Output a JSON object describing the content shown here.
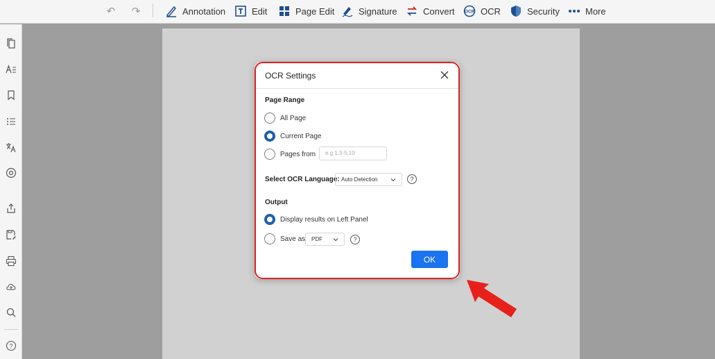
{
  "toolbar": {
    "annotation": "Annotation",
    "edit": "Edit",
    "page_edit": "Page Edit",
    "signature": "Signature",
    "convert": "Convert",
    "ocr": "OCR",
    "security": "Security",
    "more": "More"
  },
  "dialog": {
    "title": "OCR Settings",
    "page_range": {
      "label": "Page Range",
      "options": [
        "All Page",
        "Current Page",
        "Pages from"
      ],
      "selected": "Current Page",
      "pages_placeholder": "e.g 1,3-5,10"
    },
    "language": {
      "label": "Select OCR Language:",
      "value": "Auto Detection"
    },
    "output": {
      "label": "Output",
      "options": [
        "Display results on Left Panel",
        "Save as"
      ],
      "selected": "Display results on Left Panel",
      "format": "PDF"
    },
    "ok_label": "OK"
  },
  "colors": {
    "accent": "#1a73f0",
    "radio_selected": "#1f5fa8",
    "highlight": "#e02020"
  }
}
